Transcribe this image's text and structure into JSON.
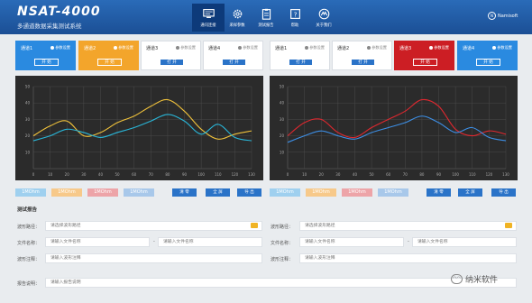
{
  "app": {
    "title": "NSAT-4000",
    "subtitle": "多通道数据采集测试系统"
  },
  "nav": [
    {
      "label": "通讯连接",
      "icon": "monitor-icon"
    },
    {
      "label": "采样参数",
      "icon": "gear-icon"
    },
    {
      "label": "测试报告",
      "icon": "clipboard-icon"
    },
    {
      "label": "帮助",
      "icon": "help-book-icon"
    },
    {
      "label": "关于我们",
      "icon": "about-icon"
    }
  ],
  "logo": {
    "text": "Namisoft",
    "mark": "N"
  },
  "channels": [
    {
      "name": "通道1",
      "param": "参数设置",
      "button": "开 始",
      "style": "blue"
    },
    {
      "name": "通道2",
      "param": "参数设置",
      "button": "开 始",
      "style": "orange"
    },
    {
      "name": "通道3",
      "param": "参数设置",
      "button": "打 开",
      "style": "white"
    },
    {
      "name": "通道4",
      "param": "参数设置",
      "button": "打 开",
      "style": "white"
    },
    {
      "name": "通道1",
      "param": "参数设置",
      "button": "打 开",
      "style": "white"
    },
    {
      "name": "通道2",
      "param": "参数设置",
      "button": "打 开",
      "style": "white"
    },
    {
      "name": "通道3",
      "param": "参数设置",
      "button": "开 始",
      "style": "red"
    },
    {
      "name": "通道4",
      "param": "参数设置",
      "button": "开 始",
      "style": "blue"
    }
  ],
  "chart_data": [
    {
      "type": "line",
      "xlim": [
        0,
        130
      ],
      "ylim": [
        0,
        50
      ],
      "x_ticks": [
        0,
        10,
        20,
        30,
        40,
        50,
        60,
        70,
        80,
        90,
        100,
        110,
        120,
        130
      ],
      "y_ticks": [
        10,
        20,
        30,
        40,
        50
      ],
      "grid": true,
      "series": [
        {
          "color": "#f0c23b",
          "x": [
            0,
            10,
            20,
            30,
            40,
            50,
            60,
            70,
            80,
            90,
            100,
            110,
            120,
            130
          ],
          "y": [
            20,
            26,
            29,
            20,
            22,
            28,
            32,
            38,
            42,
            35,
            24,
            18,
            21,
            23
          ]
        },
        {
          "color": "#29b6d8",
          "x": [
            0,
            10,
            20,
            30,
            40,
            50,
            60,
            70,
            80,
            90,
            100,
            110,
            120,
            130
          ],
          "y": [
            17,
            20,
            24,
            22,
            19,
            22,
            25,
            29,
            33,
            29,
            21,
            27,
            19,
            17
          ]
        }
      ]
    },
    {
      "type": "line",
      "xlim": [
        0,
        130
      ],
      "ylim": [
        0,
        50
      ],
      "x_ticks": [
        0,
        10,
        20,
        30,
        40,
        50,
        60,
        70,
        80,
        90,
        100,
        110,
        120,
        130
      ],
      "y_ticks": [
        10,
        20,
        30,
        40,
        50
      ],
      "grid": true,
      "series": [
        {
          "color": "#e0282f",
          "x": [
            0,
            10,
            20,
            30,
            40,
            50,
            60,
            70,
            80,
            90,
            100,
            110,
            120,
            130
          ],
          "y": [
            20,
            28,
            30,
            22,
            19,
            25,
            30,
            35,
            42,
            38,
            24,
            20,
            23,
            21
          ]
        },
        {
          "color": "#3d8fe6",
          "x": [
            0,
            10,
            20,
            30,
            40,
            50,
            60,
            70,
            80,
            90,
            100,
            110,
            120,
            130
          ],
          "y": [
            16,
            20,
            23,
            20,
            18,
            22,
            25,
            28,
            32,
            28,
            22,
            25,
            19,
            17
          ]
        }
      ]
    }
  ],
  "legends": [
    [
      {
        "label": "1MOhm",
        "color": "#9fd0ef"
      },
      {
        "label": "1MOhm",
        "color": "#f7c98a"
      },
      {
        "label": "1MOhm",
        "color": "#eda4a8"
      },
      {
        "label": "1MOhm",
        "color": "#a8c8ea"
      }
    ],
    [
      {
        "label": "1MOhm",
        "color": "#9fd0ef"
      },
      {
        "label": "1MOhm",
        "color": "#f7c98a"
      },
      {
        "label": "1MOhm",
        "color": "#eda4a8"
      },
      {
        "label": "1MOhm",
        "color": "#a8c8ea"
      }
    ]
  ],
  "chart_buttons": [
    [
      "清 零",
      "全 屏",
      "导 出"
    ],
    [
      "清 零",
      "全 屏",
      "导 出"
    ]
  ],
  "settings": {
    "title": "测试报告",
    "left": {
      "path_label": "波形路径：",
      "path_placeholder": "请选择波形路径",
      "file_label": "文件名称：",
      "file_placeholder": "请输入文件名称",
      "file2_placeholder": "请输入文件名称",
      "note_label": "波形注释：",
      "note_placeholder": "请输入波形注释"
    },
    "right": {
      "path_label": "波形路径：",
      "path_placeholder": "请选择波形路径",
      "file_label": "文件名称：",
      "file_placeholder": "请输入文件名称",
      "file2_placeholder": "请输入文件名称",
      "note_label": "波形注释：",
      "note_placeholder": "请输入波形注释"
    },
    "report_label": "报告说明：",
    "report_placeholder": "请输入报告说明"
  },
  "watermark": {
    "text": "纳米软件"
  }
}
